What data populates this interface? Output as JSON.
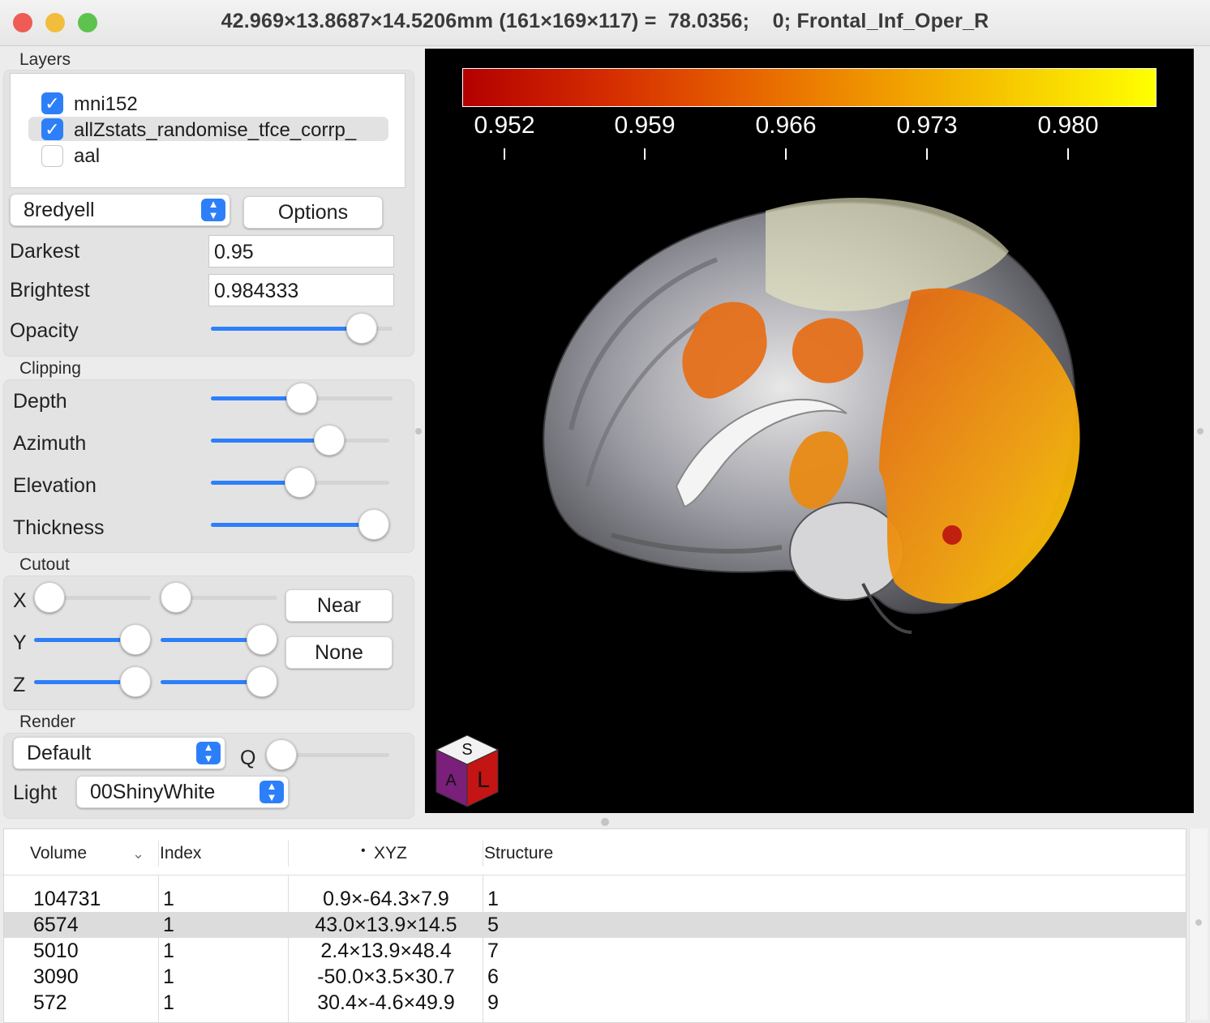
{
  "window": {
    "title": "42.969×13.8687×14.5206mm (161×169×117) =  78.0356;    0; Frontal_Inf_Oper_R",
    "traffic_lights": {
      "close": "#ee5c55",
      "minimize": "#f3bd3c",
      "zoom": "#5ec24f"
    }
  },
  "layers": {
    "section_label": "Layers",
    "items": [
      {
        "name": "mni152",
        "checked": true
      },
      {
        "name": "allZstats_randomise_tfce_corrp_",
        "checked": true,
        "selected": true
      },
      {
        "name": "aal",
        "checked": false
      }
    ],
    "colormap": "8redyell",
    "options_label": "Options",
    "darkest_label": "Darkest",
    "darkest_value": "0.95",
    "brightest_label": "Brightest",
    "brightest_value": "0.984333",
    "opacity_label": "Opacity",
    "opacity_level": 0.9
  },
  "clipping": {
    "section_label": "Clipping",
    "depth_label": "Depth",
    "depth_level": 0.5,
    "azimuth_label": "Azimuth",
    "azimuth_level": 0.7,
    "elevation_label": "Elevation",
    "elevation_level": 0.5,
    "thickness_label": "Thickness",
    "thickness_level": 1.0
  },
  "cutout": {
    "section_label": "Cutout",
    "x_label": "X",
    "y_label": "Y",
    "z_label": "Z",
    "x_lo": 0.0,
    "x_hi": 0.0,
    "y_lo": 1.0,
    "y_hi": 1.0,
    "z_lo": 1.0,
    "z_hi": 1.0,
    "near_label": "Near",
    "none_label": "None"
  },
  "render": {
    "section_label": "Render",
    "mode": "Default",
    "q_label": "Q",
    "q_level": 0.0,
    "light_label": "Light",
    "light": "00ShinyWhite"
  },
  "viewer": {
    "colorbar_ticks": [
      "0.952",
      "0.959",
      "0.966",
      "0.973",
      "0.980"
    ],
    "colorbar_colors": [
      "#b30000",
      "#d42a00",
      "#e66000",
      "#f09800",
      "#f7cc00",
      "#ffff00"
    ],
    "orientation_cube": {
      "top": "S",
      "front": "L",
      "side": "A"
    }
  },
  "table": {
    "headers": {
      "volume": "Volume",
      "index": "Index",
      "xyz": "XYZ",
      "structure": "Structure"
    },
    "sort_indicator": "•",
    "rows": [
      {
        "volume": "104731",
        "index": "1",
        "xyz": "0.9×-64.3×7.9",
        "structure": "1"
      },
      {
        "volume": "6574",
        "index": "1",
        "xyz": "43.0×13.9×14.5",
        "structure": "5",
        "selected": true
      },
      {
        "volume": "5010",
        "index": "1",
        "xyz": "2.4×13.9×48.4",
        "structure": "7"
      },
      {
        "volume": "3090",
        "index": "1",
        "xyz": "-50.0×3.5×30.7",
        "structure": "6"
      },
      {
        "volume": "572",
        "index": "1",
        "xyz": "30.4×-4.6×49.9",
        "structure": "9"
      }
    ]
  }
}
